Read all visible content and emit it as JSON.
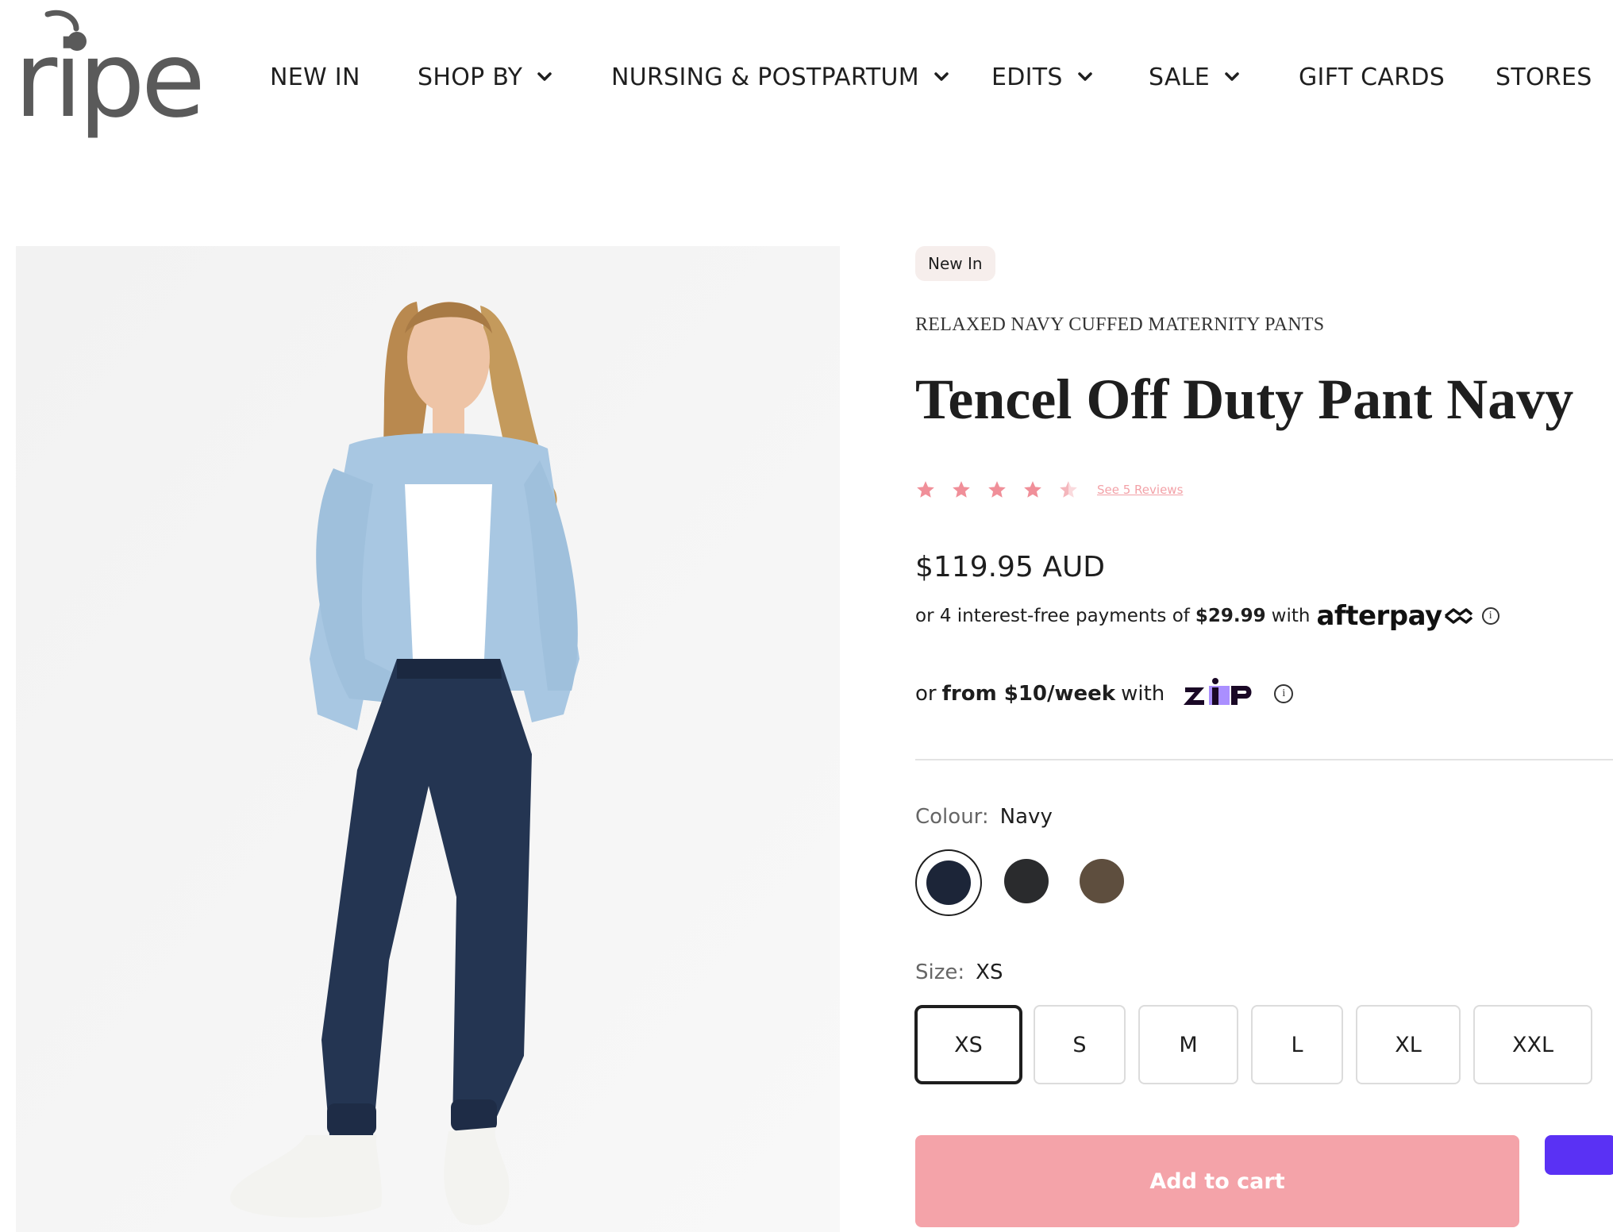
{
  "header": {
    "logo_text": "ripe",
    "nav": [
      {
        "label": "NEW IN",
        "has_dropdown": false
      },
      {
        "label": "SHOP BY",
        "has_dropdown": true
      },
      {
        "label": "NURSING & POSTPARTUM",
        "has_dropdown": true
      },
      {
        "label": "EDITS",
        "has_dropdown": true
      },
      {
        "label": "SALE",
        "has_dropdown": true
      },
      {
        "label": "GIFT CARDS",
        "has_dropdown": false
      },
      {
        "label": "STORES",
        "has_dropdown": false
      }
    ]
  },
  "product": {
    "badge": "New In",
    "subtitle": "RELAXED NAVY CUFFED MATERNITY PANTS",
    "title": "Tencel Off Duty Pant Navy",
    "rating": {
      "value": 4.5,
      "max": 5,
      "reviews_link": "See 5 Reviews"
    },
    "price": "$119.95 AUD",
    "afterpay": {
      "prefix": "or 4 interest-free payments of",
      "amount": "$29.99",
      "suffix": "with",
      "logo": "afterpay"
    },
    "zip": {
      "prefix": "or",
      "amount": "from $10/week",
      "suffix": "with",
      "logo": "zip"
    },
    "colour": {
      "label": "Colour:",
      "selected": "Navy",
      "options": [
        {
          "name": "Navy",
          "hex": "#1c2538",
          "selected": true
        },
        {
          "name": "Black",
          "hex": "#2a2b2d",
          "selected": false
        },
        {
          "name": "Brown",
          "hex": "#5e4e3e",
          "selected": false
        }
      ]
    },
    "size": {
      "label": "Size:",
      "selected": "XS",
      "options": [
        "XS",
        "S",
        "M",
        "L",
        "XL",
        "XXL"
      ]
    },
    "add_to_cart": "Add to cart"
  },
  "colors": {
    "accent_pink": "#f4a3a9",
    "star_pink": "#f08f99",
    "shop_pay_purple": "#5a31f4",
    "badge_bg": "#f6eeec"
  },
  "icons": {
    "dropdown": "chevron-down-icon",
    "info": "info-icon",
    "star": "star-icon"
  }
}
